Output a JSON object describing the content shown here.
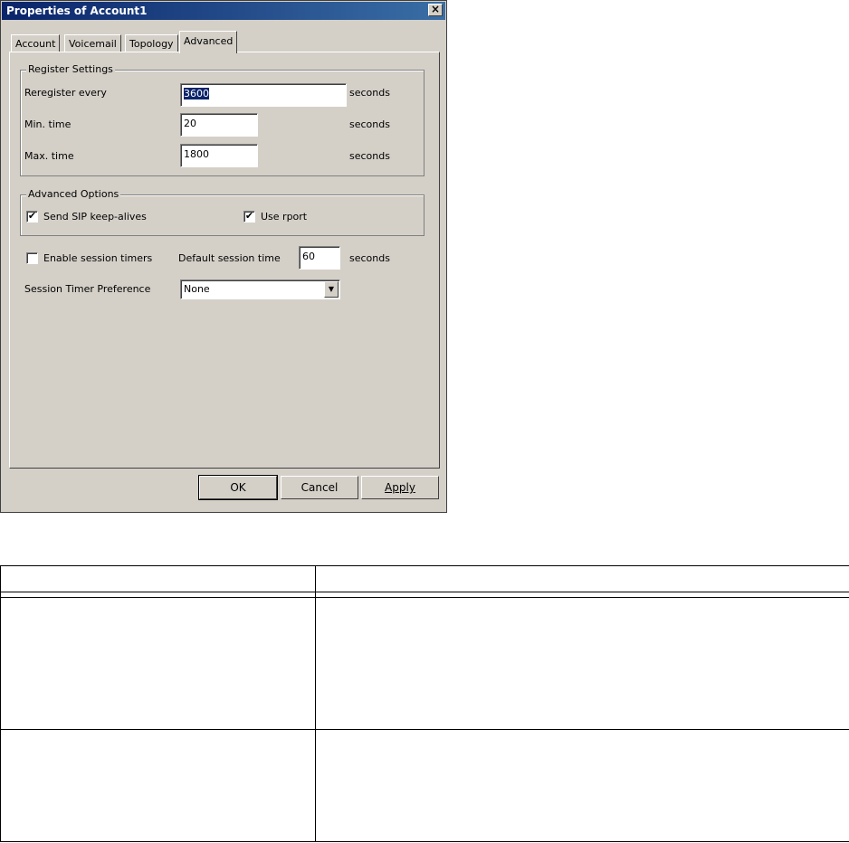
{
  "window": {
    "title": "Properties of Account1",
    "close_glyph": "×"
  },
  "tabs": [
    {
      "label": "Account"
    },
    {
      "label": "Voicemail"
    },
    {
      "label": "Topology"
    },
    {
      "label": "Advanced"
    }
  ],
  "register_settings": {
    "legend": "Register Settings",
    "reregister": {
      "label": "Reregister every",
      "value": "3600",
      "unit": "seconds"
    },
    "min_time": {
      "label": "Min. time",
      "value": "20",
      "unit": "seconds"
    },
    "max_time": {
      "label": "Max. time",
      "value": "1800",
      "unit": "seconds"
    }
  },
  "advanced_options": {
    "legend": "Advanced Options",
    "keepalives": {
      "label": "Send SIP keep-alives",
      "checked": true
    },
    "rport": {
      "label": "Use rport",
      "checked": true
    }
  },
  "session": {
    "enable_timers": {
      "label": "Enable session timers",
      "checked": false
    },
    "default_time": {
      "label": "Default session time",
      "value": "60",
      "unit": "seconds"
    },
    "preference": {
      "label": "Session Timer Preference",
      "value": "None"
    }
  },
  "buttons": {
    "ok": "OK",
    "cancel": "Cancel",
    "apply": "Apply"
  },
  "check_glyph": "✔"
}
